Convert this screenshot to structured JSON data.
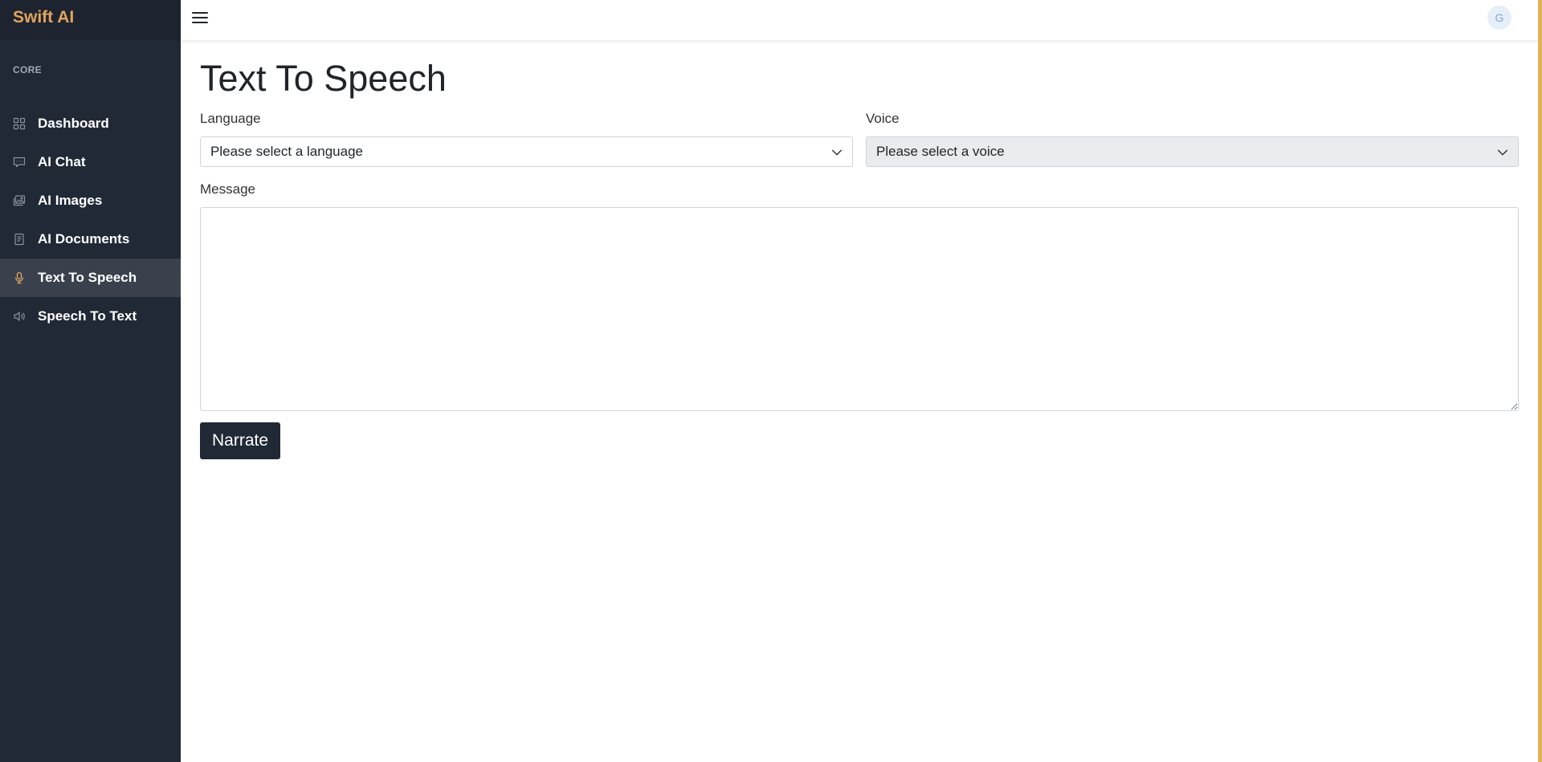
{
  "app": {
    "brand": "Swift AI"
  },
  "sidebar": {
    "section_heading": "CORE",
    "items": [
      {
        "label": "Dashboard",
        "icon": "grid-icon",
        "active": false
      },
      {
        "label": "AI Chat",
        "icon": "chat-icon",
        "active": false
      },
      {
        "label": "AI Images",
        "icon": "images-icon",
        "active": false
      },
      {
        "label": "AI Documents",
        "icon": "document-icon",
        "active": false
      },
      {
        "label": "Text To Speech",
        "icon": "microphone-icon",
        "active": true
      },
      {
        "label": "Speech To Text",
        "icon": "speaker-icon",
        "active": false
      }
    ]
  },
  "topbar": {
    "menu_icon": "hamburger-icon",
    "avatar_initial": "G"
  },
  "main": {
    "title": "Text To Speech",
    "language": {
      "label": "Language",
      "value": "Please select a language"
    },
    "voice": {
      "label": "Voice",
      "value": "Please select a voice"
    },
    "message": {
      "label": "Message",
      "value": ""
    },
    "narrate_label": "Narrate"
  },
  "colors": {
    "sidebar_bg": "#212936",
    "brand": "#e0a45e",
    "active_item_bg": "#3a414d",
    "active_icon": "#e0a45e",
    "button_bg": "#212936",
    "accent_edge": "#e0b25c"
  }
}
